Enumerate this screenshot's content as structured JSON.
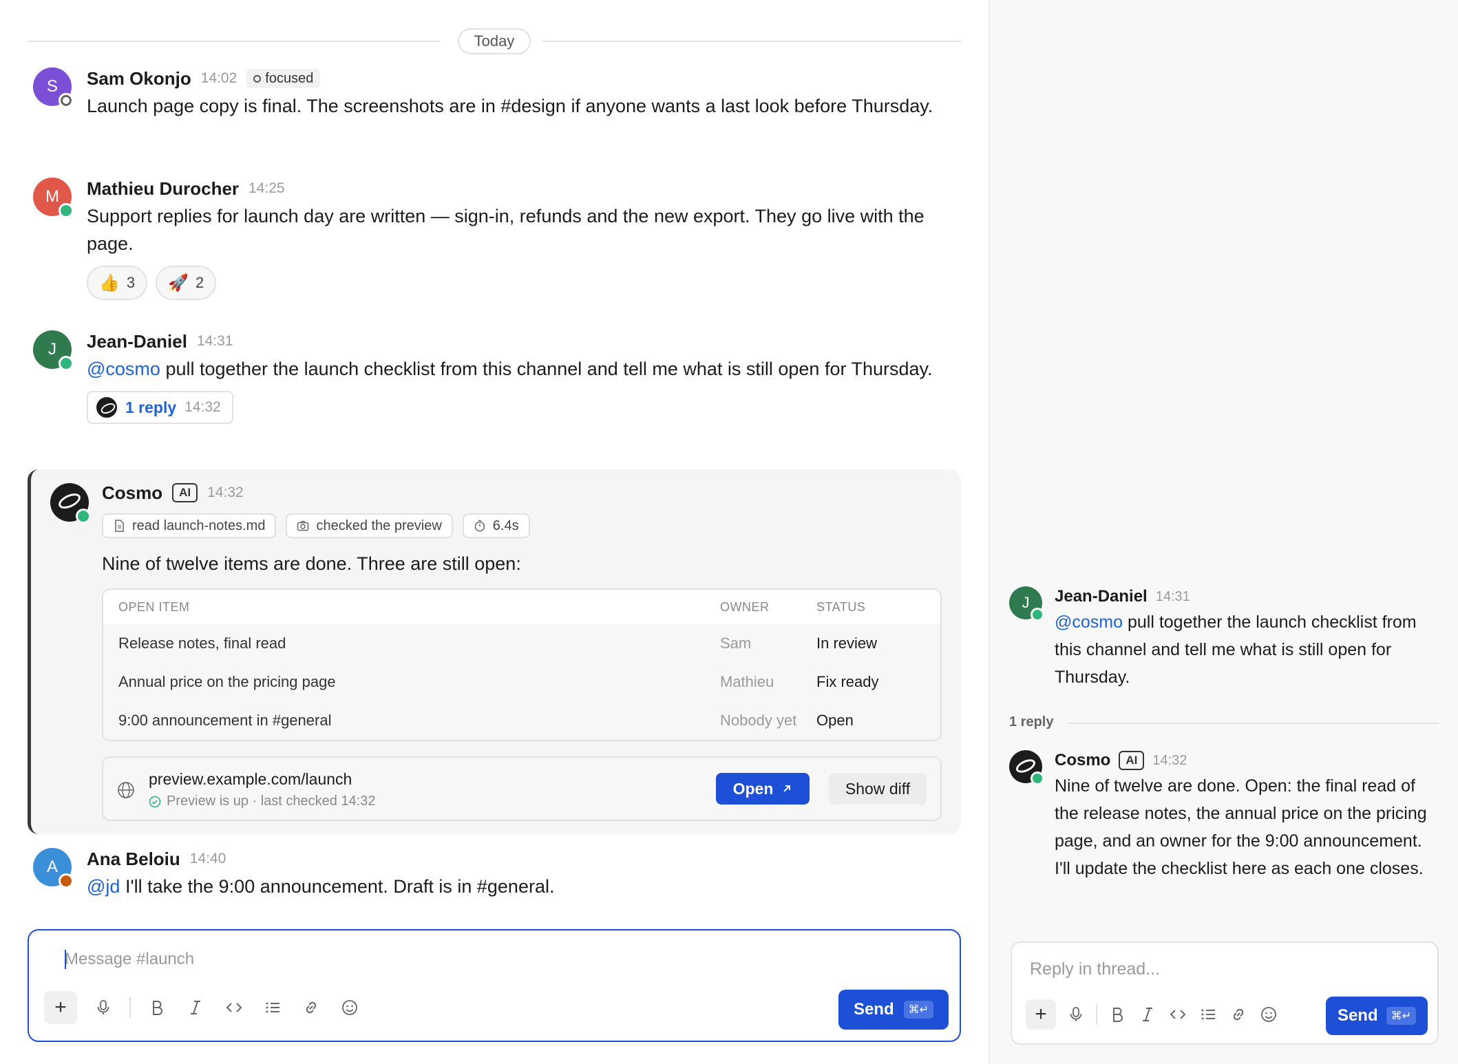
{
  "day_divider": "Today",
  "messages": [
    {
      "initial": "S",
      "name": "Sam Okonjo",
      "time": "14:02",
      "badge": "focused",
      "text": "Launch page copy is final. The screenshots are in #design if anyone wants a last look before Thursday.",
      "avatar_color": "#7b4fd6"
    },
    {
      "initial": "M",
      "name": "Mathieu Durocher",
      "time": "14:25",
      "text": "Support replies for launch day are written — sign-in, refunds and the new export. They go live with the page.",
      "avatar_color": "#e0584a",
      "reactions": [
        {
          "emoji": "👍",
          "count": "3"
        },
        {
          "emoji": "🚀",
          "count": "2"
        }
      ]
    },
    {
      "initial": "J",
      "name": "Jean-Daniel",
      "time": "14:31",
      "mention": "@cosmo",
      "text": " pull together the launch checklist from this channel and tell me what is still open for Thursday.",
      "avatar_color": "#2f7a4f",
      "thread": {
        "replies": "1 reply",
        "time": "14:32"
      }
    },
    {
      "initial": "A",
      "name": "Ana Beloiu",
      "time": "14:40",
      "mention": "@jd",
      "text": " I'll take the 9:00 announcement. Draft is in #general.",
      "avatar_color": "#3a8fd8"
    }
  ],
  "cosmo": {
    "name": "Cosmo",
    "ai_label": "AI",
    "time": "14:32",
    "tools": [
      "read launch-notes.md",
      "checked the preview",
      "6.4s"
    ],
    "summary": "Nine of twelve items are done. Three are still open:",
    "table": {
      "headers": [
        "OPEN ITEM",
        "OWNER",
        "STATUS"
      ],
      "rows": [
        [
          "Release notes, final read",
          "Sam",
          "In review"
        ],
        [
          "Annual price on the pricing page",
          "Mathieu",
          "Fix ready"
        ],
        [
          "9:00 announcement in #general",
          "Nobody yet",
          "Open"
        ]
      ]
    },
    "preview": {
      "url": "preview.example.com/launch",
      "status": "Preview is up · last checked 14:32",
      "open_label": "Open",
      "diff_label": "Show diff"
    }
  },
  "composer": {
    "placeholder": "Message #launch",
    "send_label": "Send",
    "shortcut": "⌘↵"
  },
  "thread_panel": {
    "parent": {
      "initial": "J",
      "name": "Jean-Daniel",
      "time": "14:31",
      "mention": "@cosmo",
      "text": " pull together the launch checklist from this channel and tell me what is still open for Thursday."
    },
    "reply_count": "1 reply",
    "reply": {
      "name": "Cosmo",
      "ai_label": "AI",
      "time": "14:32",
      "text": "Nine of twelve are done. Open: the final read of the release notes, the annual price on the pricing page, and an owner for the 9:00 announcement. I'll update the checklist here as each one closes."
    },
    "composer": {
      "placeholder": "Reply in thread...",
      "send_label": "Send",
      "shortcut": "⌘↵"
    }
  },
  "colors": {
    "accent": "#1d4fd7",
    "mention": "#1d63d6",
    "online": "#2eb67d"
  }
}
